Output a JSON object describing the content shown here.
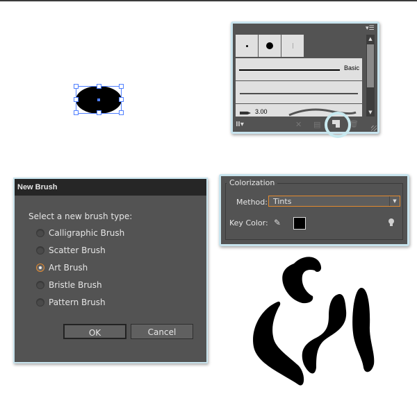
{
  "brushes_panel": {
    "menu_icon": "panel-menu-icon",
    "brushes": [
      {
        "type": "dot",
        "size": "small"
      },
      {
        "type": "dot",
        "size": "large"
      },
      {
        "type": "dot",
        "size": "thin"
      },
      {
        "type": "line",
        "label": "Basic"
      },
      {
        "type": "charcoal"
      },
      {
        "type": "art",
        "size_label": "3.00"
      }
    ],
    "footer_icons": [
      "brush-libraries-icon",
      "remove-stroke-icon",
      "brush-options-icon",
      "new-brush-icon",
      "delete-brush-icon"
    ],
    "footer": {
      "library_glyph": "Ⅲ▾",
      "remove_glyph": "✕",
      "options_glyph": "▤",
      "delete_glyph": "🗑"
    }
  },
  "new_brush_dialog": {
    "title": "New Brush",
    "prompt": "Select a new brush type:",
    "options": [
      {
        "label": "Calligraphic Brush",
        "checked": false
      },
      {
        "label": "Scatter Brush",
        "checked": false
      },
      {
        "label": "Art Brush",
        "checked": true
      },
      {
        "label": "Bristle Brush",
        "checked": false
      },
      {
        "label": "Pattern Brush",
        "checked": false
      }
    ],
    "ok_label": "OK",
    "cancel_label": "Cancel"
  },
  "colorization": {
    "legend": "Colorization",
    "method_label": "Method:",
    "method_value": "Tints",
    "key_color_label": "Key Color:",
    "key_color": "#000000",
    "accent_color": "#e38a2f"
  },
  "glyphs": {
    "up": "▲",
    "down": "▼",
    "menu": "▾☰",
    "eyedropper": "✎"
  }
}
